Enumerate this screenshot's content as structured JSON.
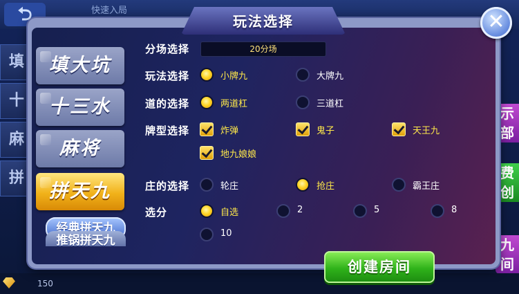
{
  "background": {
    "quick_join": "快速入局",
    "left_tabs": [
      "填",
      "十",
      "麻",
      "拼"
    ],
    "right_buttons": [
      "示部",
      "费创",
      "九间"
    ],
    "coins": "150"
  },
  "dialog": {
    "title": "玩法选择",
    "close_icon": "close-icon"
  },
  "sidebar": {
    "items": [
      {
        "label": "填大坑",
        "active": false
      },
      {
        "label": "十三水",
        "active": false
      },
      {
        "label": "麻将",
        "active": false
      },
      {
        "label": "拼天九",
        "active": true
      }
    ],
    "sub_items": [
      "经典拼天九",
      "推锅拼天九"
    ]
  },
  "rows": {
    "venue": {
      "label": "分场选择",
      "value": "20分场"
    },
    "play": {
      "label": "玩法选择",
      "options": [
        {
          "label": "小牌九",
          "selected": true
        },
        {
          "label": "大牌九",
          "selected": false
        }
      ]
    },
    "lanes": {
      "label": "道的选择",
      "options": [
        {
          "label": "两道杠",
          "selected": true
        },
        {
          "label": "三道杠",
          "selected": false
        }
      ]
    },
    "card_types": {
      "label": "牌型选择",
      "options": [
        {
          "label": "炸弹",
          "checked": true
        },
        {
          "label": "鬼子",
          "checked": true
        },
        {
          "label": "天王九",
          "checked": true
        },
        {
          "label": "地九娘娘",
          "checked": true
        }
      ]
    },
    "banker": {
      "label": "庄的选择",
      "options": [
        {
          "label": "轮庄",
          "selected": false
        },
        {
          "label": "抢庄",
          "selected": true
        },
        {
          "label": "霸王庄",
          "selected": false
        }
      ]
    },
    "score": {
      "label": "选分",
      "options": [
        {
          "label": "自选",
          "selected": true
        },
        {
          "label": "2",
          "selected": false
        },
        {
          "label": "5",
          "selected": false
        },
        {
          "label": "8",
          "selected": false
        },
        {
          "label": "10",
          "selected": false
        }
      ]
    }
  },
  "create_button": "创建房间",
  "colors": {
    "accent_yellow": "#ffe94a",
    "button_green": "#2fb21a",
    "active_tab": "#f1b21a"
  }
}
